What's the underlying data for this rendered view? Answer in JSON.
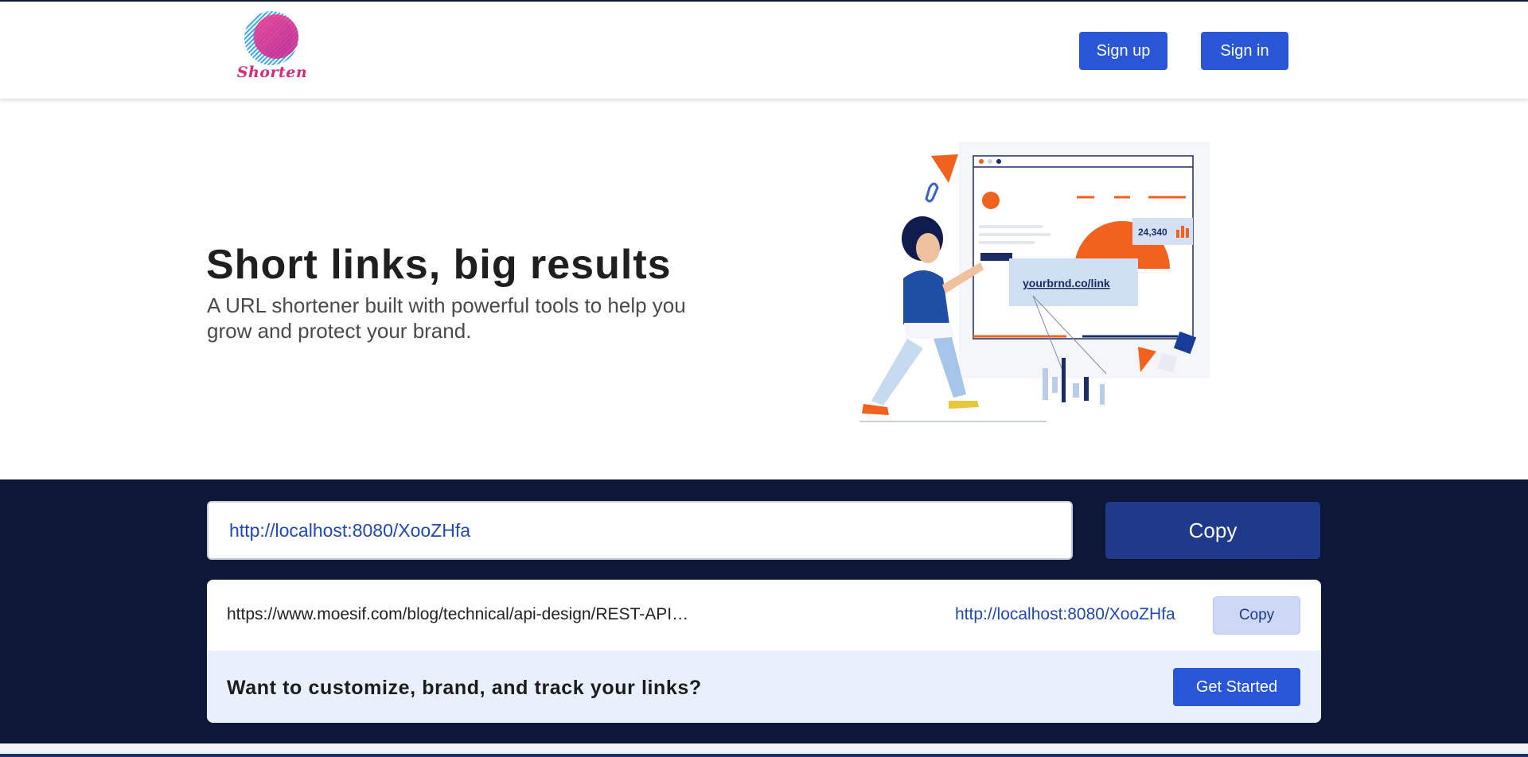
{
  "header": {
    "logo_text": "Shorten",
    "signup_label": "Sign up",
    "signin_label": "Sign in"
  },
  "hero": {
    "title": "Short links, big results",
    "subtitle": "A URL shortener built with powerful tools to help you grow and protect your brand.",
    "illustration": {
      "browser_link_text": "yourbrnd.co/link",
      "stat_value": "24,340"
    }
  },
  "shortener": {
    "input_value": "http://localhost:8080/XooZHfa",
    "copy_label": "Copy"
  },
  "result": {
    "long_url": "https://www.moesif.com/blog/technical/api-design/REST-API…",
    "short_url": "http://localhost:8080/XooZHfa",
    "copy_label": "Copy"
  },
  "promo": {
    "text": "Want to customize, brand, and track your links?",
    "button_label": "Get Started"
  },
  "colors": {
    "primary": "#2856d6",
    "dark_band": "#0d1738",
    "copy_main": "#1f3a8a",
    "copy_small": "#ccd8f5",
    "link": "#1f49b6",
    "logo_pink": "#d42b7a",
    "accent_orange": "#f0621e"
  }
}
